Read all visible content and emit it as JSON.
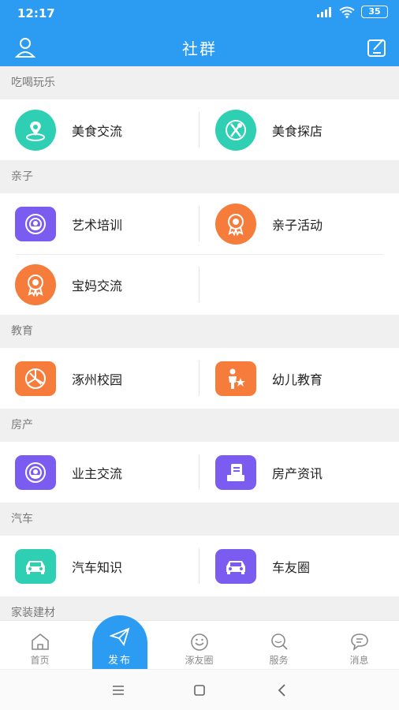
{
  "status_bar": {
    "time": "12:17",
    "battery": "35",
    "icons": [
      "signal-icon",
      "wifi-icon",
      "battery-icon"
    ]
  },
  "header": {
    "title": "社群",
    "left_icon": "user-icon",
    "right_icon": "compose-icon"
  },
  "sections": [
    {
      "title": "吃喝玩乐",
      "items": [
        {
          "label": "美食交流",
          "icon": "location-pin-icon",
          "color": "#2ecfb3"
        },
        {
          "label": "美食探店",
          "icon": "fork-spoon-icon",
          "color": "#2ecfb3"
        }
      ]
    },
    {
      "title": "亲子",
      "items": [
        {
          "label": "艺术培训",
          "icon": "broadcast-icon",
          "color": "#7b5cf0"
        },
        {
          "label": "亲子活动",
          "icon": "medal-icon",
          "color": "#f57c3a"
        },
        {
          "label": "宝妈交流",
          "icon": "medal-icon",
          "color": "#f57c3a"
        }
      ]
    },
    {
      "title": "教育",
      "items": [
        {
          "label": "涿州校园",
          "icon": "aperture-icon",
          "color": "#f57c3a"
        },
        {
          "label": "幼儿教育",
          "icon": "parent-child-icon",
          "color": "#f57c3a"
        }
      ]
    },
    {
      "title": "房产",
      "items": [
        {
          "label": "业主交流",
          "icon": "broadcast-icon",
          "color": "#7b5cf0"
        },
        {
          "label": "房产资讯",
          "icon": "news-icon",
          "color": "#7b5cf0"
        }
      ]
    },
    {
      "title": "汽车",
      "items": [
        {
          "label": "汽车知识",
          "icon": "car-icon",
          "color": "#2ecfb3"
        },
        {
          "label": "车友圈",
          "icon": "car-icon",
          "color": "#7b5cf0"
        }
      ]
    },
    {
      "title": "家装建材",
      "items": []
    }
  ],
  "tabbar": {
    "home": "首页",
    "publish": "发布",
    "friends": "涿友圈",
    "service": "服务",
    "messages": "消息"
  },
  "colors": {
    "primary": "#2b9cf2",
    "teal": "#2ecfb3",
    "purple": "#7b5cf0",
    "orange": "#f57c3a"
  }
}
